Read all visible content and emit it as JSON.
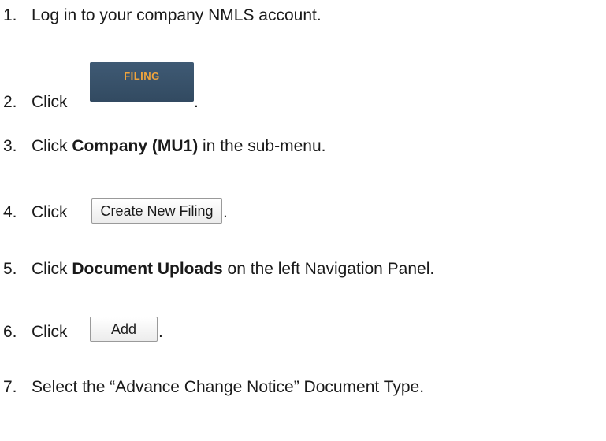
{
  "steps": [
    {
      "number": "1.",
      "text": "Log in to your company NMLS account."
    },
    {
      "number": "2.",
      "prefix": "Click",
      "button_label": "FILING",
      "suffix": "."
    },
    {
      "number": "3.",
      "prefix": "Click",
      "bold": "Company (MU1)",
      "suffix": "in the sub-menu."
    },
    {
      "number": "4.",
      "prefix": "Click",
      "button_label": "Create New Filing",
      "suffix": "."
    },
    {
      "number": "5.",
      "prefix": "Click",
      "bold": "Document Uploads",
      "suffix": "on the left Navigation Panel."
    },
    {
      "number": "6.",
      "prefix": "Click",
      "button_label": "Add",
      "suffix": "."
    },
    {
      "number": "7.",
      "text": "Select the “Advance Change Notice” Document Type."
    }
  ],
  "colors": {
    "filing_bg": "#3a536b",
    "filing_text": "#f0a43c"
  }
}
